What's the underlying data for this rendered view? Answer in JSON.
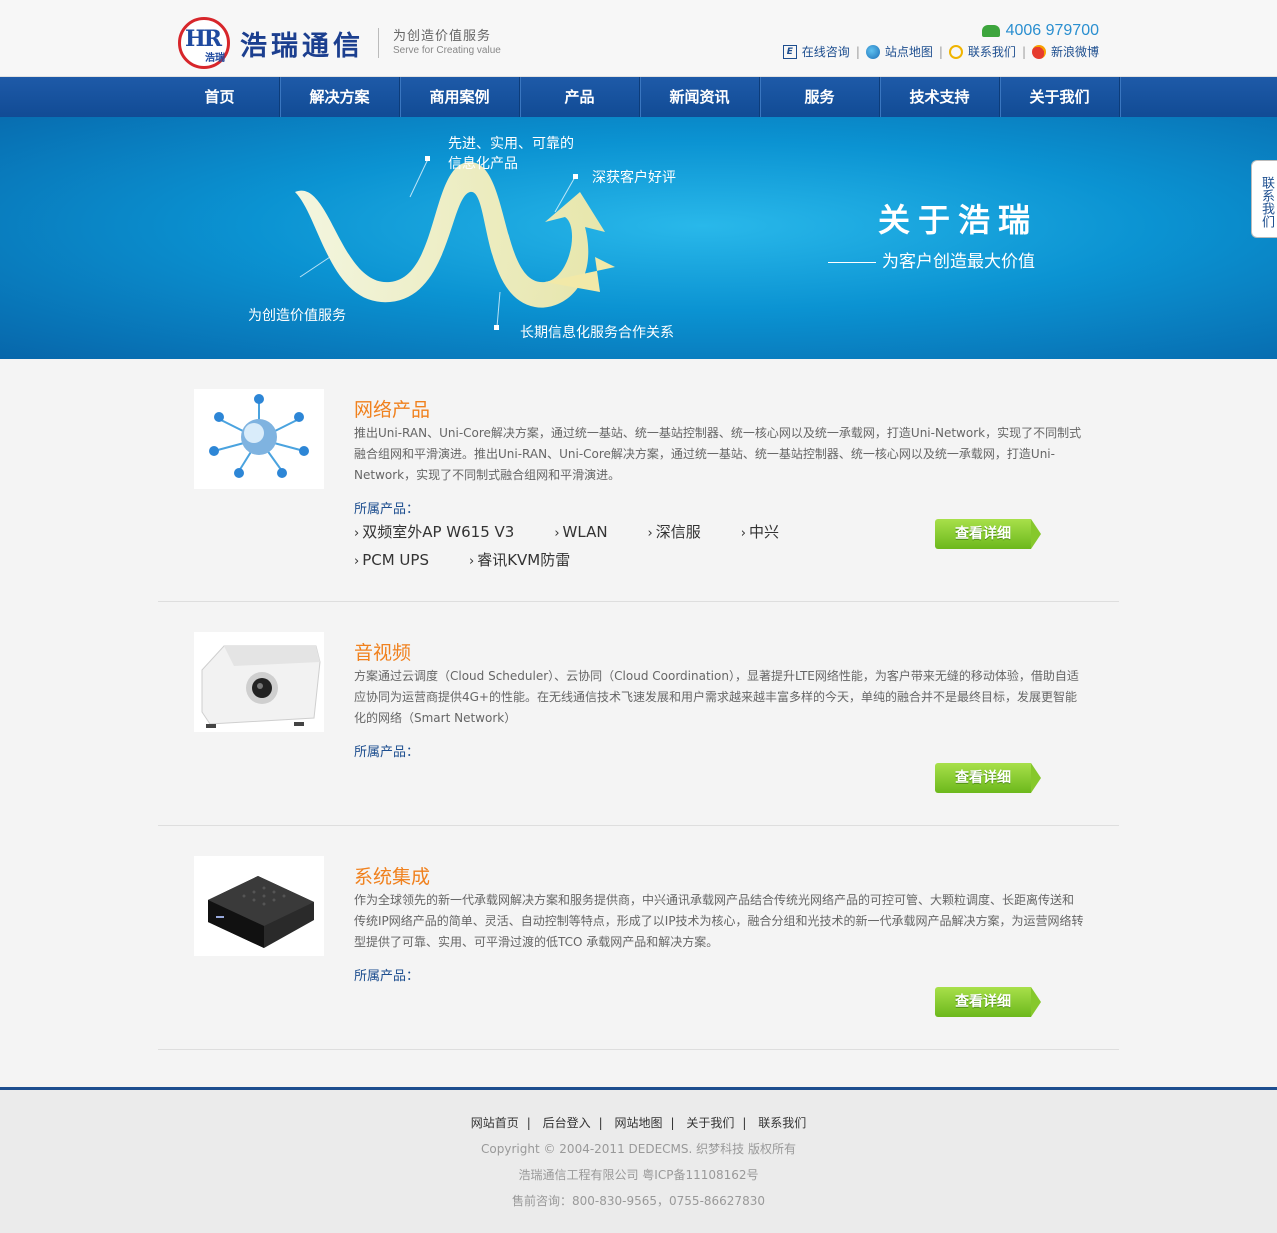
{
  "header": {
    "logo_mark": "HR",
    "logo_mark_cn": "浩瑞",
    "logo_text": "浩瑞通信",
    "slogan_cn": "为创造价值服务",
    "slogan_en": "Serve for Creating value",
    "phone": "4006 979700",
    "links": [
      {
        "label": "在线咨询",
        "icon": "e-icon"
      },
      {
        "label": "站点地图",
        "icon": "globe-icon"
      },
      {
        "label": "联系我们",
        "icon": "chat-bubble-icon"
      },
      {
        "label": "新浪微博",
        "icon": "weibo-icon"
      }
    ]
  },
  "nav": [
    "首页",
    "解决方案",
    "商用案例",
    "产品",
    "新闻资讯",
    "服务",
    "技术支持",
    "关于我们"
  ],
  "banner": {
    "labels": [
      "先进、实用、可靠的",
      "信息化产品",
      "深获客户好评",
      "为创造价值服务",
      "长期信息化服务合作关系"
    ],
    "title": "关于浩瑞",
    "subtitle": "为客户创造最大价值",
    "side_tab": "联系我们"
  },
  "products": [
    {
      "title": "网络产品",
      "desc": " 推出Uni-RAN、Uni-Core解决方案，通过统一基站、统一基站控制器、统一核心网以及统一承载网，打造Uni-Network，实现了不同制式融合组网和平滑演进。推出Uni-RAN、Uni-Core解决方案，通过统一基站、统一基站控制器、统一核心网以及统一承载网，打造Uni-Network，实现了不同制式融合组网和平滑演进。",
      "label": "所属产品：",
      "tags": [
        "双频室外AP W615 V3",
        "WLAN",
        "深信服",
        "中兴",
        "PCM UPS",
        "睿讯KVM防雷"
      ],
      "button": "查看详细"
    },
    {
      "title": "音视频",
      "desc": "方案通过云调度（Cloud Scheduler）、云协同（Cloud Coordination），显著提升LTE网络性能，为客户带来无缝的移动体验，借助自适应协同为运营商提供4G+的性能。在无线通信技术飞速发展和用户需求越来越丰富多样的今天，单纯的融合并不是最终目标，发展更智能化的网络（Smart Network）",
      "label": "所属产品：",
      "tags": [],
      "button": "查看详细"
    },
    {
      "title": "系统集成",
      "desc": "作为全球领先的新一代承载网解决方案和服务提供商，中兴通讯承载网产品结合传统光网络产品的可控可管、大颗粒调度、长距离传送和传统IP网络产品的简单、灵活、自动控制等特点，形成了以IP技术为核心，融合分组和光技术的新一代承载网产品解决方案，为运营网络转型提供了可靠、实用、可平滑过渡的低TCO 承载网产品和解决方案。",
      "label": "所属产品：",
      "tags": [],
      "button": "查看详细"
    }
  ],
  "footer": {
    "links": [
      "网站首页",
      "后台登入",
      "网站地图",
      "关于我们",
      "联系我们"
    ],
    "copyright": "Copyright © 2004-2011 DEDECMS. 织梦科技 版权所有",
    "company": "浩瑞通信工程有限公司 粤ICP备11108162号",
    "contact": "售前咨询：800-830-9565，0755-86627830"
  },
  "colors": {
    "nav_blue": "#1556a0",
    "accent_orange": "#f0811e",
    "button_green": "#86c82b",
    "footer_rule": "#1d4e8f"
  }
}
